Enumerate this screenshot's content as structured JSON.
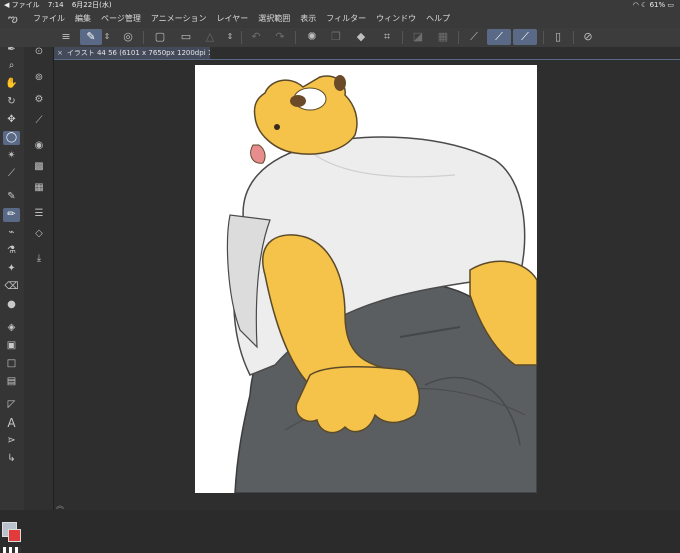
{
  "status_bar": {
    "back_label": "◀ ファイル",
    "time": "7:14",
    "date": "6月22日(水)",
    "battery": "61%"
  },
  "menu": {
    "items": [
      "ファイル",
      "編集",
      "ページ管理",
      "アニメーション",
      "レイヤー",
      "選択範囲",
      "表示",
      "フィルター",
      "ウィンドウ",
      "ヘルプ"
    ]
  },
  "document": {
    "tab_title": "イラスト 44 56 (6101 x 7650px 1200dpi 18.3%)"
  },
  "colors": {
    "accent": "#5a6a86",
    "foreground": "#b9c2cc",
    "background": "#e23b3b",
    "character_yellow": "#f5c34a",
    "shirt": "#ededed",
    "pants": "#5b5e60"
  },
  "toolbar_icons": [
    "pen-nib-icon",
    "zoom-icon",
    "hand-icon",
    "rotate-icon",
    "move-icon",
    "lasso-select-icon",
    "magic-wand-icon",
    "eyedropper-icon",
    "pen-icon",
    "pencil-icon",
    "brush-icon",
    "airbrush-icon",
    "sparkle-icon",
    "eraser-icon",
    "blend-icon",
    "fill-icon",
    "gradient-icon",
    "rectangle-icon",
    "frame-icon",
    "ruler-icon",
    "text-icon",
    "balloon-icon",
    "correct-line-icon"
  ]
}
